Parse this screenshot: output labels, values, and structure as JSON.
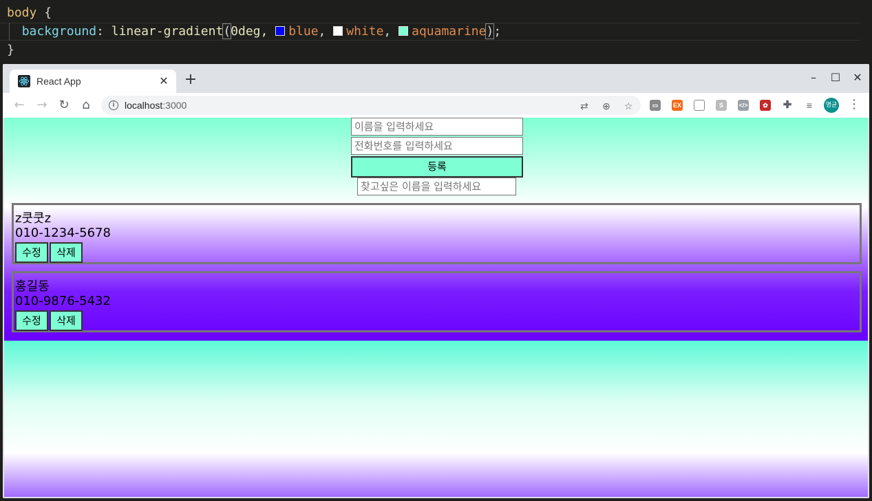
{
  "editor": {
    "line1_selector": "body",
    "line1_brace": " {",
    "line2_prop": "background",
    "line2_colon": ": ",
    "line2_fn": "linear-gradient",
    "line2_arg0": "0deg, ",
    "line2_c1": "blue",
    "line2_sep1": ", ",
    "line2_c2": "white",
    "line2_sep2": ", ",
    "line2_c3": "aquamarine",
    "line2_end": ";",
    "line3": "}",
    "swatch_colors": [
      "#0000ff",
      "#ffffff",
      "#7fffd4"
    ]
  },
  "browser": {
    "tab_title": "React App",
    "tab_close": "✕",
    "new_tab": "+",
    "url_host": "localhost",
    "url_port": ":3000",
    "avatar_text": "명균",
    "window_controls": [
      "–",
      "☐",
      "✕"
    ]
  },
  "form": {
    "name_placeholder": "이름을 입력하세요",
    "phone_placeholder": "전화번호를 입력하세요",
    "submit_label": "등록",
    "search_placeholder": "찾고싶은 이름을 입력하세요"
  },
  "contacts": [
    {
      "name": "z쿳쿳z",
      "phone": "010-1234-5678",
      "edit_label": "수정",
      "delete_label": "삭제"
    },
    {
      "name": "홍길동",
      "phone": "010-9876-5432",
      "edit_label": "수정",
      "delete_label": "삭제"
    }
  ],
  "colors": {
    "accent_button": "#7fffd4",
    "gradient": [
      "blue",
      "white",
      "aquamarine"
    ]
  }
}
